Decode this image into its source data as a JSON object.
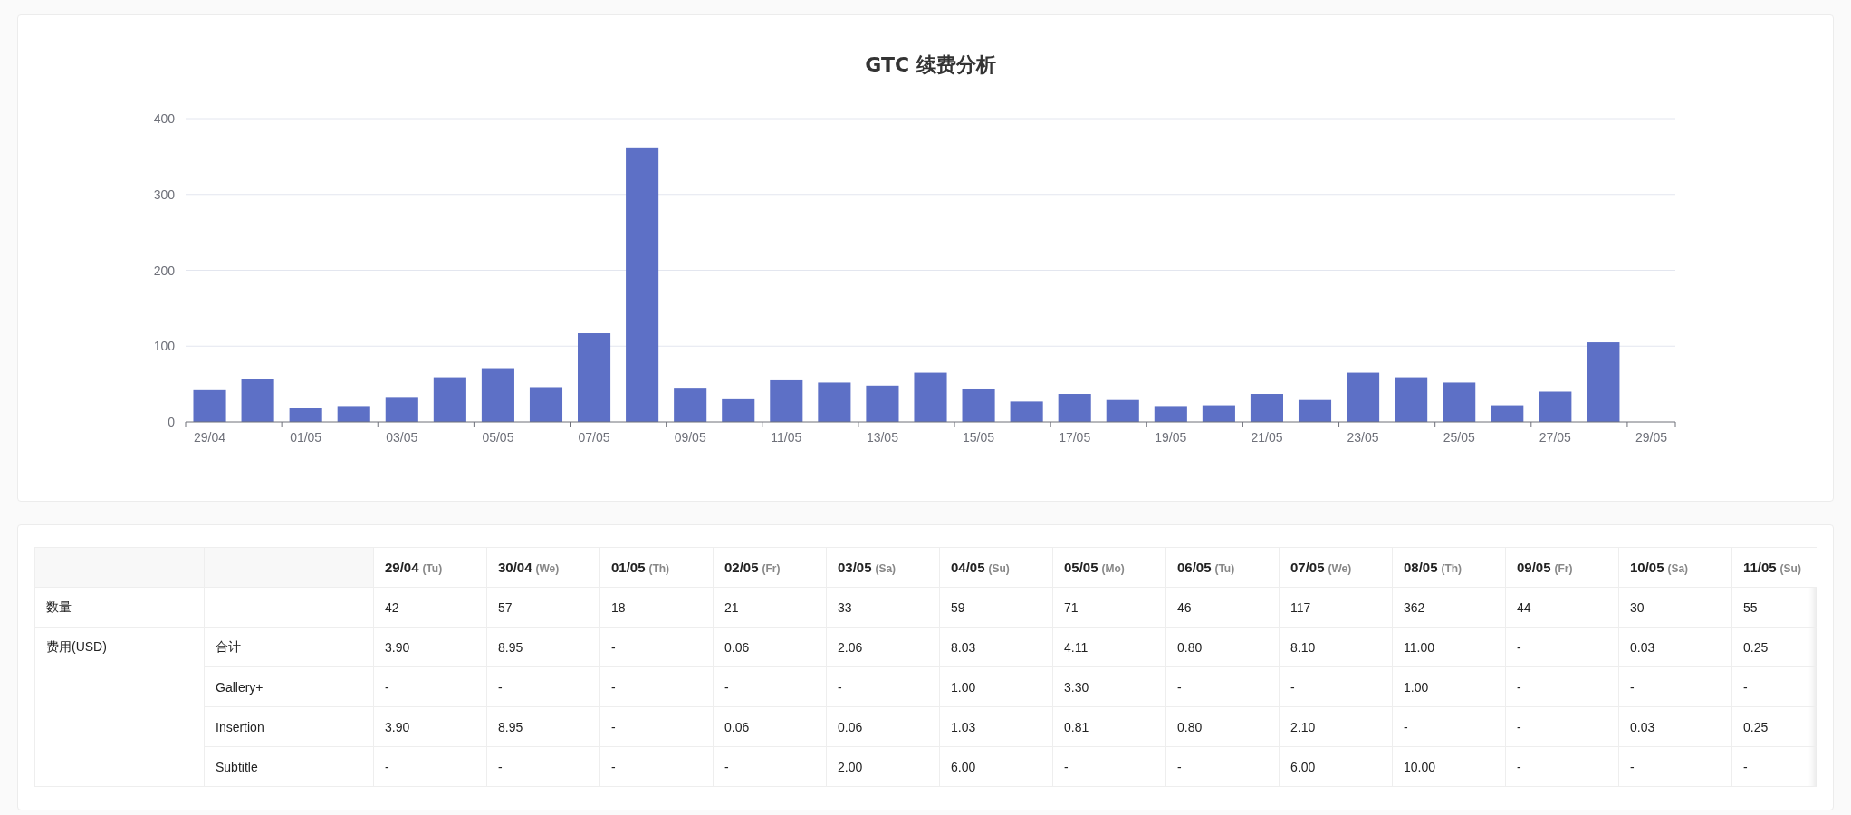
{
  "chart": {
    "chart_data": {
      "type": "bar",
      "title": "GTC 续费分析",
      "categories": [
        "29/04",
        null,
        "01/05",
        null,
        "03/05",
        null,
        "05/05",
        null,
        "07/05",
        null,
        "09/05",
        null,
        "11/05",
        null,
        "13/05",
        null,
        "15/05",
        null,
        "17/05",
        null,
        "19/05",
        null,
        "21/05",
        null,
        "23/05",
        null,
        "25/05",
        null,
        "27/05",
        null,
        "29/05"
      ],
      "grid": true,
      "series": [
        {
          "color": "#5d70c6",
          "values": [
            42,
            57,
            18,
            21,
            33,
            59,
            71,
            46,
            117,
            362,
            44,
            30,
            55,
            52,
            48,
            65,
            43,
            27,
            37,
            29,
            21,
            22,
            37,
            29,
            65,
            59,
            52,
            22,
            40,
            105,
            null
          ]
        }
      ],
      "ylim": [
        0,
        400
      ],
      "yticks": [
        0,
        100,
        200,
        300,
        400
      ]
    }
  },
  "table": {
    "columns": [
      {
        "date": "29/04",
        "weekday": "(Tu)"
      },
      {
        "date": "30/04",
        "weekday": "(We)"
      },
      {
        "date": "01/05",
        "weekday": "(Th)"
      },
      {
        "date": "02/05",
        "weekday": "(Fr)"
      },
      {
        "date": "03/05",
        "weekday": "(Sa)"
      },
      {
        "date": "04/05",
        "weekday": "(Su)"
      },
      {
        "date": "05/05",
        "weekday": "(Mo)"
      },
      {
        "date": "06/05",
        "weekday": "(Tu)"
      },
      {
        "date": "07/05",
        "weekday": "(We)"
      },
      {
        "date": "08/05",
        "weekday": "(Th)"
      },
      {
        "date": "09/05",
        "weekday": "(Fr)"
      },
      {
        "date": "10/05",
        "weekday": "(Sa)"
      },
      {
        "date": "11/05",
        "weekday": "(Su)"
      }
    ],
    "rows": [
      {
        "label": "数量",
        "values": [
          "42",
          "57",
          "18",
          "21",
          "33",
          "59",
          "71",
          "46",
          "117",
          "362",
          "44",
          "30",
          "55"
        ]
      },
      {
        "label": "费用(USD)",
        "children": [
          {
            "label": "合计",
            "values": [
              "3.90",
              "8.95",
              "-",
              "0.06",
              "2.06",
              "8.03",
              "4.11",
              "0.80",
              "8.10",
              "11.00",
              "-",
              "0.03",
              "0.25"
            ]
          },
          {
            "label": "Gallery+",
            "values": [
              "-",
              "-",
              "-",
              "-",
              "-",
              "1.00",
              "3.30",
              "-",
              "-",
              "1.00",
              "-",
              "-",
              "-"
            ]
          },
          {
            "label": "Insertion",
            "values": [
              "3.90",
              "8.95",
              "-",
              "0.06",
              "0.06",
              "1.03",
              "0.81",
              "0.80",
              "2.10",
              "-",
              "-",
              "0.03",
              "0.25"
            ]
          },
          {
            "label": "Subtitle",
            "values": [
              "-",
              "-",
              "-",
              "-",
              "2.00",
              "6.00",
              "-",
              "-",
              "6.00",
              "10.00",
              "-",
              "-",
              "-"
            ]
          }
        ]
      }
    ]
  }
}
